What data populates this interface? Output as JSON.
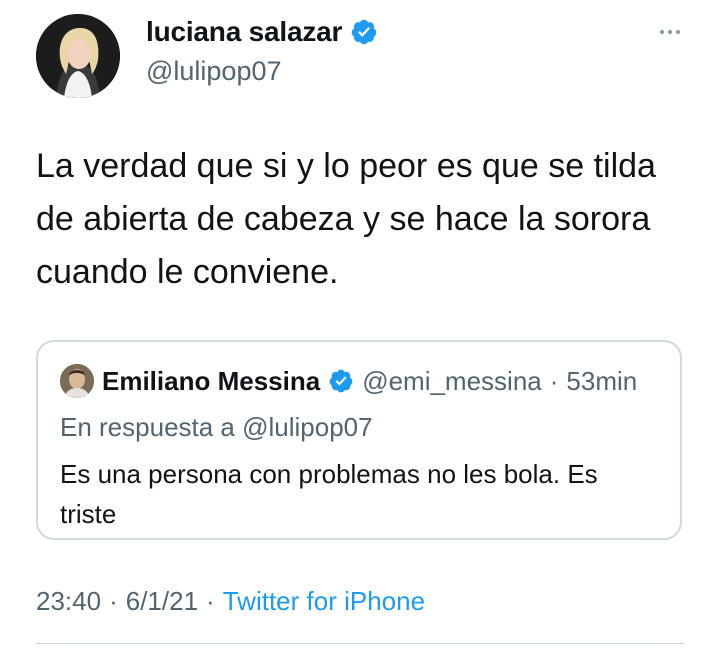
{
  "tweet": {
    "author": {
      "display_name": "luciana salazar",
      "handle": "@lulipop07",
      "verified": true
    },
    "text": "La verdad que si y lo peor es que se tilda de abierta de cabeza y se hace la sorora cuando le conviene.",
    "quoted": {
      "display_name": "Emiliano Messina",
      "verified": true,
      "handle": "@emi_messina",
      "separator": "·",
      "time": "53min",
      "reply_to": "En respuesta a @lulipop07",
      "text": "Es una persona con problemas no les bola. Es triste"
    },
    "meta": {
      "time": "23:40",
      "separator1": "·",
      "date": "6/1/21",
      "separator2": "·",
      "source": "Twitter for iPhone"
    }
  },
  "icons": {
    "verified": "verified-badge-icon",
    "more": "more-options-icon"
  },
  "colors": {
    "text": "#0f1419",
    "secondary": "#536471",
    "link": "#1d9bf0",
    "border": "#cfd9de",
    "verified": "#1d9bf0"
  }
}
